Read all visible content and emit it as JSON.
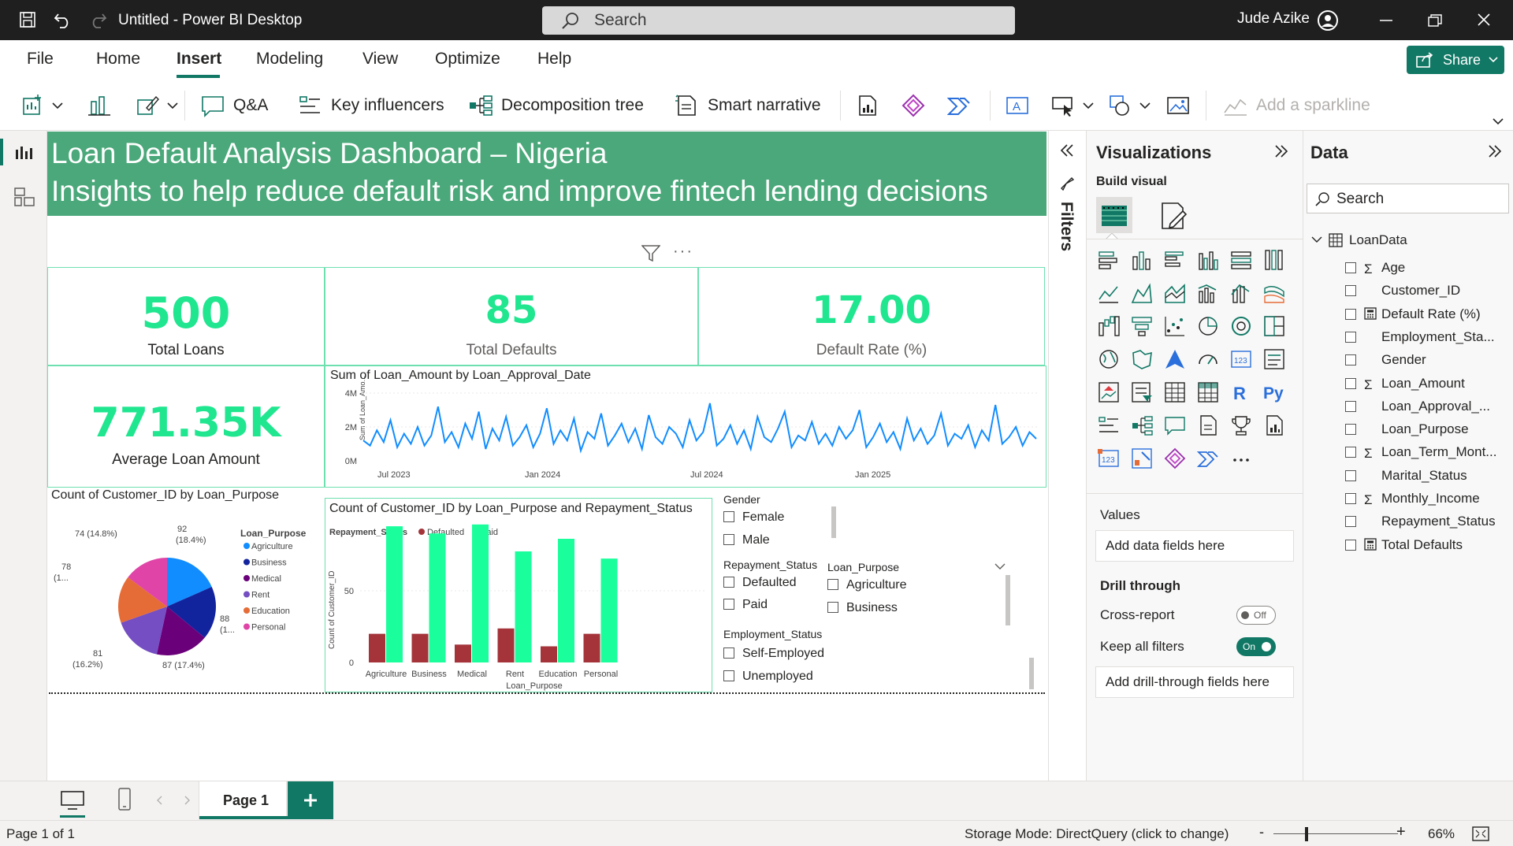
{
  "window": {
    "title": "Untitled - Power BI Desktop",
    "search_placeholder": "Search",
    "user": "Jude Azike",
    "share": "Share"
  },
  "menu": [
    "File",
    "Home",
    "Insert",
    "Modeling",
    "View",
    "Optimize",
    "Help"
  ],
  "ribbon": {
    "qa": "Q&A",
    "key_influencers": "Key influencers",
    "decomposition": "Decomposition tree",
    "smart_narrative": "Smart narrative",
    "sparkline": "Add a sparkline"
  },
  "report": {
    "title": "Loan Default Analysis Dashboard – Nigeria",
    "subtitle": "Insights to help reduce default risk and improve fintech lending decisions",
    "kpi": [
      {
        "value": "500",
        "label": "Total Loans"
      },
      {
        "value": "85",
        "label": "Total Defaults"
      },
      {
        "value": "17.00",
        "label": "Default Rate (%)"
      },
      {
        "value": "771.35K",
        "label": "Average Loan Amount"
      }
    ]
  },
  "line_chart": {
    "title": "Sum of Loan_Amount by Loan_Approval_Date",
    "ylabel": "Sum of Loan_Amo...",
    "yticks": [
      "4M",
      "2M",
      "0M"
    ],
    "xticks": [
      "Jul 2023",
      "Jan 2024",
      "Jul 2024",
      "Jan 2025"
    ]
  },
  "pie_chart": {
    "title": "Count of Customer_ID by Loan_Purpose",
    "legend_title": "Loan_Purpose",
    "labels": {
      "agri": "92",
      "agri2": "(18.4%)",
      "bus": "88",
      "bus2": "(1...",
      "med": "87 (17.4%)",
      "rent": "81",
      "rent2": "(16.2%)",
      "edu": "78",
      "edu2": "(1...",
      "pers": "74 (14.8%)"
    }
  },
  "bar_chart": {
    "title": "Count of Customer_ID by Loan_Purpose and Repayment_Status",
    "legend_title": "Repayment_Status",
    "ylabel": "Count of Customer_ID",
    "xlabel": "Loan_Purpose",
    "yticks": [
      "50",
      "0"
    ]
  },
  "chart_data": [
    {
      "type": "line",
      "title": "Sum of Loan_Amount by Loan_Approval_Date",
      "xlabel": "",
      "ylabel": "Sum of Loan_Amo...",
      "ylim": [
        0,
        4000000
      ],
      "x_range": [
        "2023-06",
        "2025-06"
      ],
      "series": [
        {
          "name": "Loan_Amount",
          "values": [
            1.2,
            0.9,
            1.8,
            1.1,
            2.4,
            0.8,
            1.6,
            1.0,
            2.0,
            0.9,
            1.5,
            3.2,
            1.1,
            1.7,
            0.8,
            2.2,
            1.3,
            2.9,
            0.7,
            1.9,
            1.2,
            2.6,
            0.9,
            1.4,
            2.1,
            0.8,
            1.6,
            3.1,
            1.0,
            1.8,
            1.2,
            2.5,
            0.6,
            1.7,
            1.3,
            2.8,
            0.9,
            1.5,
            2.2,
            1.1,
            1.9,
            0.7,
            2.7,
            1.4,
            1.0,
            2.0,
            1.6,
            0.8,
            2.4,
            1.2,
            1.7,
            3.4,
            0.9,
            1.3,
            2.1,
            1.0,
            1.8,
            0.7,
            2.6,
            1.4,
            1.1,
            1.9,
            2.9,
            0.8,
            1.5,
            1.2,
            2.3,
            1.0,
            1.6,
            0.9,
            2.0,
            1.3,
            1.8,
            3.0,
            0.8,
            1.4,
            2.2,
            1.1,
            1.7,
            0.7,
            2.5,
            1.2,
            1.9,
            1.0,
            1.5,
            2.8,
            0.9,
            1.6,
            1.3,
            2.1,
            0.8,
            1.8,
            1.2,
            3.3,
            1.0,
            1.4,
            2.0,
            0.9,
            1.7,
            1.3
          ]
        }
      ]
    },
    {
      "type": "pie",
      "title": "Count of Customer_ID by Loan_Purpose",
      "categories": [
        "Agriculture",
        "Business",
        "Medical",
        "Rent",
        "Education",
        "Personal"
      ],
      "values": [
        92,
        88,
        87,
        81,
        78,
        74
      ]
    },
    {
      "type": "bar",
      "title": "Count of Customer_ID by Loan_Purpose and Repayment_Status",
      "categories": [
        "Agriculture",
        "Business",
        "Medical",
        "Rent",
        "Education",
        "Personal"
      ],
      "xlabel": "Loan_Purpose",
      "ylabel": "Count of Customer_ID",
      "ylim": [
        0,
        80
      ],
      "series": [
        {
          "name": "Defaulted",
          "values": [
            16,
            16,
            10,
            19,
            9,
            16
          ]
        },
        {
          "name": "Paid",
          "values": [
            76,
            72,
            77,
            62,
            69,
            58
          ]
        }
      ]
    }
  ],
  "colors": {
    "agri": "#118dff",
    "bus": "#12239e",
    "med": "#6b007b",
    "rent": "#744ec2",
    "edu": "#e66c37",
    "pers": "#e044a7",
    "defaulted": "#a4343a",
    "paid": "#1aff9c",
    "line": "#118dff",
    "header": "#4aa87a",
    "kpi": "#1fe68f"
  },
  "slicers": {
    "gender": {
      "title": "Gender",
      "items": [
        "Female",
        "Male"
      ]
    },
    "repayment": {
      "title": "Repayment_Status",
      "items": [
        "Defaulted",
        "Paid"
      ]
    },
    "purpose": {
      "title": "Loan_Purpose",
      "items": [
        "Agriculture",
        "Business"
      ]
    },
    "employment": {
      "title": "Employment_Status",
      "items": [
        "Self-Employed",
        "Unemployed"
      ]
    }
  },
  "filters_label": "Filters",
  "viz_pane": {
    "title": "Visualizations",
    "build": "Build visual",
    "values": "Values",
    "values_well": "Add data fields here",
    "drill": "Drill through",
    "cross": "Cross-report",
    "cross_state": "Off",
    "keep": "Keep all filters",
    "keep_state": "On",
    "drill_well": "Add drill-through fields here"
  },
  "data_pane": {
    "title": "Data",
    "search": "Search",
    "table": "LoanData",
    "fields": [
      {
        "name": "Age",
        "sigma": true
      },
      {
        "name": "Customer_ID"
      },
      {
        "name": "Default Rate (%)",
        "calc": true
      },
      {
        "name": "Employment_Sta..."
      },
      {
        "name": "Gender"
      },
      {
        "name": "Loan_Amount",
        "sigma": true
      },
      {
        "name": "Loan_Approval_..."
      },
      {
        "name": "Loan_Purpose"
      },
      {
        "name": "Loan_Term_Mont...",
        "sigma": true
      },
      {
        "name": "Marital_Status"
      },
      {
        "name": "Monthly_Income",
        "sigma": true
      },
      {
        "name": "Repayment_Status"
      },
      {
        "name": "Total Defaults",
        "calc": true
      }
    ]
  },
  "pages": {
    "page1": "Page 1"
  },
  "status": {
    "page": "Page 1 of 1",
    "storage": "Storage Mode: DirectQuery (click to change)",
    "zoom": "66%"
  }
}
